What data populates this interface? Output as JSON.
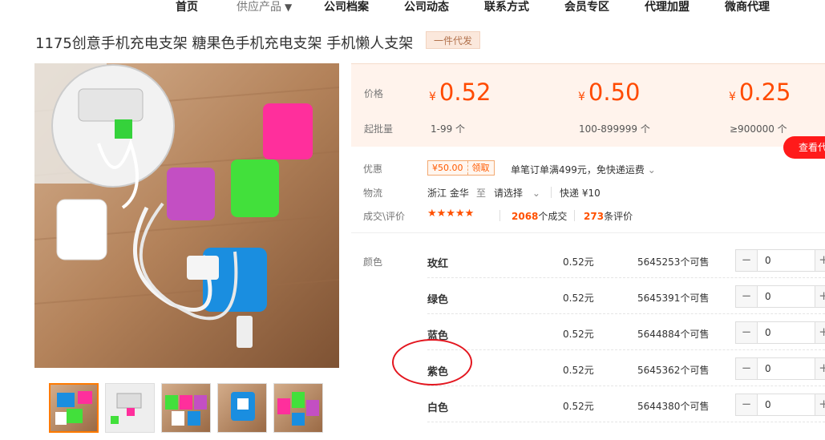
{
  "nav": {
    "items": [
      {
        "label": "首页"
      },
      {
        "label": "供应产品"
      },
      {
        "label": "公司档案"
      },
      {
        "label": "公司动态"
      },
      {
        "label": "联系方式"
      },
      {
        "label": "会员专区"
      },
      {
        "label": "代理加盟"
      },
      {
        "label": "微商代理"
      }
    ],
    "caret": "▼"
  },
  "product": {
    "title": "1175创意手机充电支架 糖果色手机充电支架 手机懒人支架",
    "tag": "一件代发"
  },
  "gallery": {
    "thumb_count": 5,
    "active_index": 0
  },
  "pricing": {
    "price_label": "价格",
    "moq_label": "起批量",
    "currency": "¥",
    "tiers": [
      {
        "price": "0.52",
        "range": "1-99 个"
      },
      {
        "price": "0.50",
        "range": "100-899999 个"
      },
      {
        "price": "0.25",
        "range": "≥900000 个"
      }
    ],
    "view_button": "查看代"
  },
  "offer": {
    "label": "优惠",
    "coupon_value": "¥50.00",
    "coupon_action": "领取",
    "note": "单笔订单满499元，免快递运费"
  },
  "logistics": {
    "label": "物流",
    "from": "浙江 金华",
    "to_word": "至",
    "select_text": "请选择",
    "shipping": "快递 ¥10"
  },
  "rating": {
    "label": "成交\\评价",
    "stars": "★★★★★",
    "deals_count": "2068",
    "deals_suffix": "个成交",
    "reviews_count": "273",
    "reviews_suffix": "条评价"
  },
  "sku": {
    "label": "颜色",
    "rows": [
      {
        "name": "玫红",
        "price": "0.52元",
        "stock": "5645253个可售",
        "qty": "0"
      },
      {
        "name": "绿色",
        "price": "0.52元",
        "stock": "5645391个可售",
        "qty": "0"
      },
      {
        "name": "蓝色",
        "price": "0.52元",
        "stock": "5644884个可售",
        "qty": "0"
      },
      {
        "name": "紫色",
        "price": "0.52元",
        "stock": "5645362个可售",
        "qty": "0"
      },
      {
        "name": "白色",
        "price": "0.52元",
        "stock": "5644380个可售",
        "qty": "0"
      }
    ],
    "minus": "−",
    "plus": "+"
  },
  "colors": {
    "accent": "#ff5000",
    "price_panel_bg": "#fff3ec",
    "annotation": "#e3161f",
    "button_red": "#ff1a1a"
  }
}
